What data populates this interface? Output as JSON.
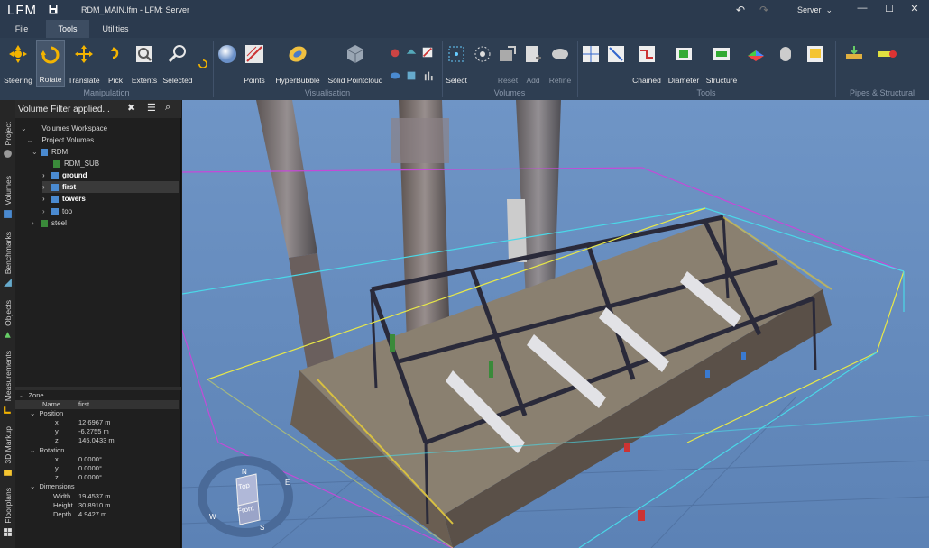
{
  "app": {
    "logo": "LFM",
    "title": "RDM_MAIN.lfm - LFM: Server",
    "server_label": "Server",
    "server_chevron": "chevron-down-icon"
  },
  "menu": {
    "tabs": [
      {
        "label": "File"
      },
      {
        "label": "Tools"
      },
      {
        "label": "Utilities"
      }
    ],
    "active": "Tools"
  },
  "ribbon": {
    "manipulation": {
      "group": "Manipulation",
      "buttons": [
        {
          "label": "Steering"
        },
        {
          "label": "Rotate"
        },
        {
          "label": "Translate"
        },
        {
          "label": "Pick"
        },
        {
          "label": "Extents"
        },
        {
          "label": "Selected"
        }
      ]
    },
    "visualisation": {
      "group": "Visualisation",
      "buttons": [
        {
          "label": "Points"
        },
        {
          "label": "HyperBubble"
        },
        {
          "label": "Solid Pointcloud"
        }
      ]
    },
    "volumes": {
      "group": "Volumes",
      "buttons": [
        {
          "label": "Select"
        },
        {
          "label": "Reset"
        },
        {
          "label": "Add"
        },
        {
          "label": "Refine"
        }
      ]
    },
    "tools": {
      "group": "Tools",
      "buttons": [
        {
          "label": "Chained"
        },
        {
          "label": "Diameter"
        },
        {
          "label": "Structure"
        }
      ]
    },
    "pipes": {
      "group": "Pipes & Structural"
    }
  },
  "side_tabs": [
    {
      "label": "Project"
    },
    {
      "label": "Volumes"
    },
    {
      "label": "Benchmarks"
    },
    {
      "label": "Objects"
    },
    {
      "label": "Measurements"
    },
    {
      "label": "3D Markup"
    },
    {
      "label": "Floorplans"
    }
  ],
  "panel": {
    "title": "Volume Filter applied...",
    "tree": [
      {
        "label": "Volumes Workspace"
      },
      {
        "label": "Project Volumes"
      },
      {
        "label": "RDM"
      },
      {
        "label": "RDM_SUB"
      },
      {
        "label": "ground"
      },
      {
        "label": "first"
      },
      {
        "label": "towers"
      },
      {
        "label": "top"
      },
      {
        "label": "steel"
      }
    ],
    "props": {
      "zone": "Zone",
      "name_key": "Name",
      "name_val": "first",
      "position": "Position",
      "px": "12.6967 m",
      "py": "-6.2755 m",
      "pz": "145.0433 m",
      "rotation": "Rotation",
      "rx": "0.0000°",
      "ry": "0.0000°",
      "rz": "0.0000°",
      "dimensions": "Dimensions",
      "width_key": "Width",
      "width_val": "19.4537 m",
      "height_key": "Height",
      "height_val": "30.8910 m",
      "depth_key": "Depth",
      "depth_val": "4.9427 m",
      "x": "x",
      "y": "y",
      "z": "z"
    }
  },
  "compass": {
    "top": "Top",
    "front": "Front",
    "n": "N",
    "e": "E",
    "s": "S",
    "w": "W"
  }
}
